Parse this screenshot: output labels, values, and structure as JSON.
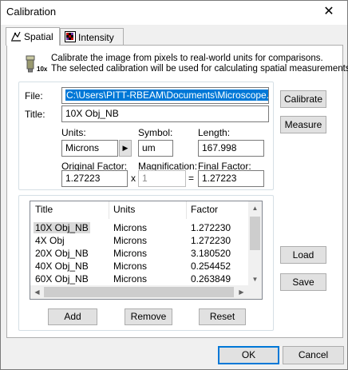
{
  "window": {
    "title": "Calibration",
    "close_glyph": "✕"
  },
  "tabs": [
    {
      "label": "Spatial",
      "icon": "spatial-icon",
      "active": true
    },
    {
      "label": "Intensity",
      "icon": "intensity-icon",
      "active": false
    }
  ],
  "info": {
    "icon": "microscope-icon",
    "icon_caption": "10x",
    "line1": "Calibrate the image from pixels to real-world units for comparisons.",
    "line2": "The selected calibration will be used for calculating spatial measurements"
  },
  "form": {
    "file_label": "File:",
    "file_value": "C:\\Users\\PITT-RBEAM\\Documents\\Microscope.cal",
    "title_label": "Title:",
    "title_value": "10X Obj_NB",
    "units_label": "Units:",
    "units_value": "Microns",
    "units_arrow": "▶",
    "symbol_label": "Symbol:",
    "symbol_value": "um",
    "length_label": "Length:",
    "length_value": "167.998",
    "orig_factor_label": "Original Factor:",
    "orig_factor_value": "1.27223",
    "times_sign": "x",
    "magnification_label": "Magnification:",
    "magnification_value": "1",
    "equals_sign": "=",
    "final_factor_label": "Final Factor:",
    "final_factor_value": "1.27223"
  },
  "side_buttons": {
    "calibrate": "Calibrate",
    "measure": "Measure",
    "load": "Load",
    "save": "Save"
  },
  "list": {
    "columns": [
      "Title",
      "Units",
      "Factor"
    ],
    "rows": [
      {
        "title": "10X Obj_NB",
        "units": "Microns",
        "factor": "1.272230",
        "selected": true
      },
      {
        "title": "4X Obj",
        "units": "Microns",
        "factor": "1.272230",
        "selected": false
      },
      {
        "title": "20X Obj_NB",
        "units": "Microns",
        "factor": "3.180520",
        "selected": false
      },
      {
        "title": "40X Obj_NB",
        "units": "Microns",
        "factor": "0.254452",
        "selected": false
      },
      {
        "title": "60X Obj_NB",
        "units": "Microns",
        "factor": "0.263849",
        "selected": false
      }
    ]
  },
  "list_buttons": {
    "add": "Add",
    "remove": "Remove",
    "reset": "Reset"
  },
  "footer": {
    "ok": "OK",
    "cancel": "Cancel"
  }
}
